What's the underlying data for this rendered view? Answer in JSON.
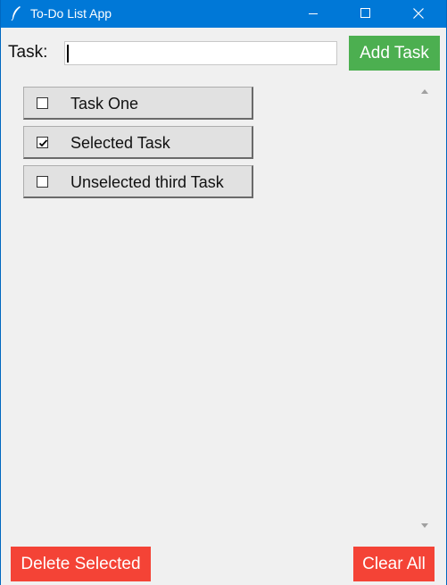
{
  "window": {
    "title": "To-Do List App",
    "icon": "feather-icon",
    "controls": [
      "minimize-icon",
      "maximize-icon",
      "close-icon"
    ],
    "titlebar_color": "#0078d7"
  },
  "entry": {
    "label": "Task:",
    "value": "",
    "add_label": "Add Task",
    "add_color": "#4caf50"
  },
  "tasks": [
    {
      "label": "Task One",
      "checked": false
    },
    {
      "label": "Selected Task",
      "checked": true
    },
    {
      "label": "Unselected third Task",
      "checked": false
    }
  ],
  "footer": {
    "delete_label": "Delete Selected",
    "clear_label": "Clear All",
    "button_color": "#f44336"
  }
}
